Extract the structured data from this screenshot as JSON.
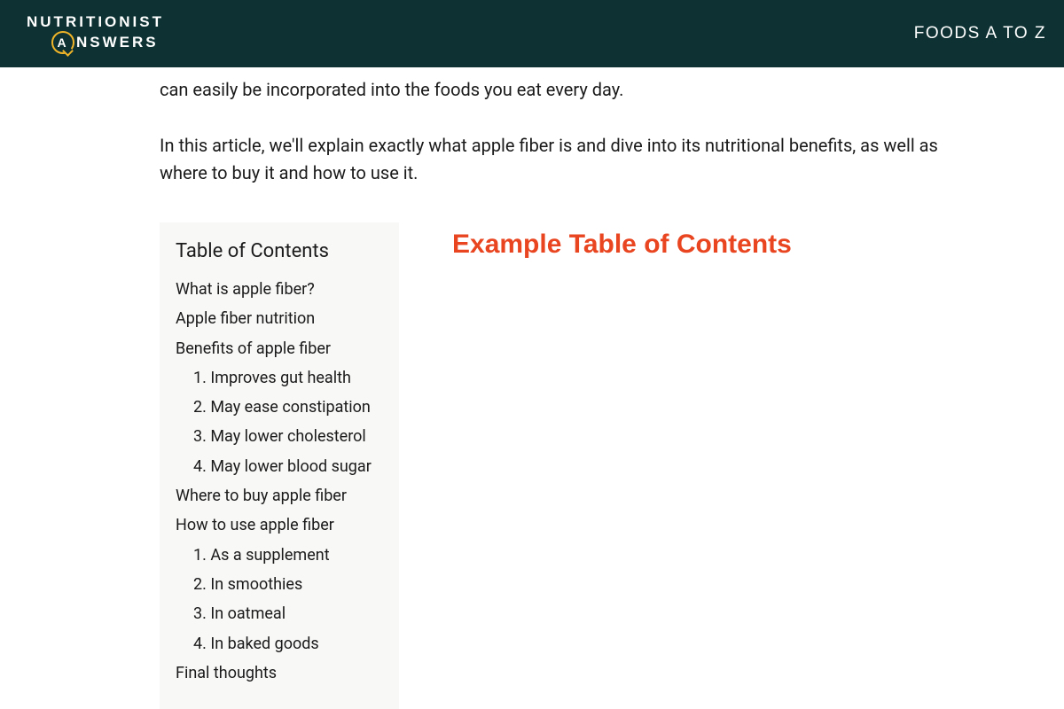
{
  "header": {
    "logo_line1": "NUTRITIONIST",
    "logo_a": "A",
    "logo_line2_rest": "NSWERS",
    "nav_foods": "FOODS A TO Z"
  },
  "article": {
    "p1": "can easily be incorporated into the foods you eat every day.",
    "p2": "In this article, we'll explain exactly what apple fiber is and dive into its nutritional benefits, as well as where to buy it and how to use it."
  },
  "toc": {
    "title": "Table of Contents",
    "items": [
      "What is apple fiber?",
      "Apple fiber nutrition",
      "Benefits of apple fiber"
    ],
    "benefits_sub": [
      "1. Improves gut health",
      "2. May ease constipation",
      "3. May lower cholesterol",
      "4. May lower blood sugar"
    ],
    "items2": [
      "Where to buy apple fiber",
      "How to use apple fiber"
    ],
    "howto_sub": [
      "1. As a supplement",
      "2. In smoothies",
      "3. In oatmeal",
      "4. In baked goods"
    ],
    "items3": [
      "Final thoughts"
    ]
  },
  "example_label": "Example Table of Contents"
}
